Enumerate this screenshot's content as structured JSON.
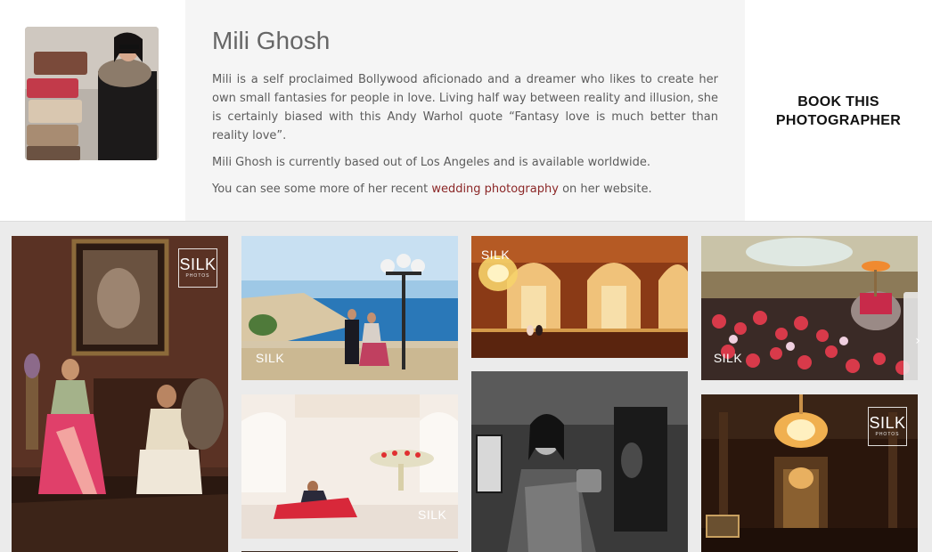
{
  "profile": {
    "name": "Mili Ghosh",
    "bio_paragraph_1": "Mili is a self proclaimed Bollywood aficionado and a dreamer who likes to create her own small fantasies for people in love.  Living half way between reality and illusion, she is certainly biased with this Andy Warhol quote “Fantasy love is much better than reality love”.",
    "bio_paragraph_2": "Mili Ghosh is currently based out of Los Angeles and is available worldwide.",
    "bio_paragraph_3_before": "You can see some more of her recent ",
    "bio_paragraph_3_link": "wedding photography",
    "bio_paragraph_3_after": " on her website.",
    "book_button_line1": "BOOK THIS",
    "book_button_line2": "PHOTOGRAPHER"
  },
  "gallery": {
    "watermark": "SILK",
    "watermark_sub": "PHOTOS",
    "next_arrow": "›"
  },
  "colors": {
    "link": "#8b2727",
    "panel_bg": "#f5f5f5",
    "gallery_bg": "#ebebeb"
  }
}
